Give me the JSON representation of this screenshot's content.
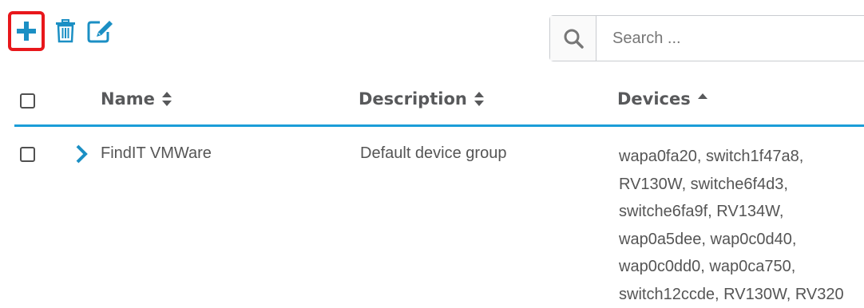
{
  "toolbar": {
    "add": {
      "icon": "plus-icon",
      "highlight_color": "#e8171b"
    },
    "delete": {
      "icon": "trash-icon"
    },
    "edit": {
      "icon": "edit-icon"
    },
    "icon_color": "#1b8fc4"
  },
  "search": {
    "placeholder": "Search ...",
    "value": "",
    "icon": "search-icon"
  },
  "table": {
    "columns": [
      {
        "label": "Name",
        "sort": "both"
      },
      {
        "label": "Description",
        "sort": "both"
      },
      {
        "label": "Devices",
        "sort": "ascending"
      }
    ],
    "accent_color": "#1b9dd8",
    "rows": [
      {
        "checked": false,
        "expanded": false,
        "name": "FindIT VMWare",
        "description": "Default device group",
        "devices": [
          "wapa0fa20, switch1f47a8,",
          "RV130W, switche6f4d3,",
          "switche6fa9f, RV134W,",
          "wap0a5dee, wap0c0d40,",
          "wap0c0dd0, wap0ca750,",
          "switch12ccde, RV130W, RV320"
        ]
      }
    ]
  }
}
